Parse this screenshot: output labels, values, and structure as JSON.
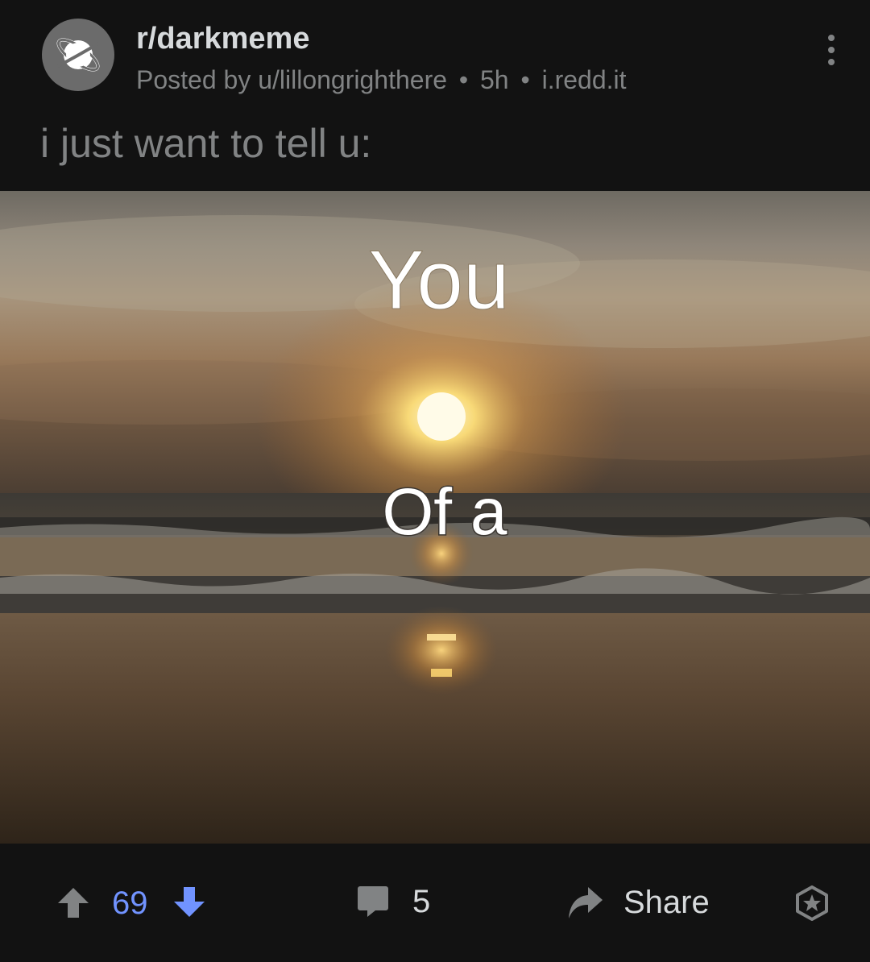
{
  "post": {
    "subreddit": "r/darkmeme",
    "posted_by": "Posted by u/lillongrighthere",
    "age": "5h",
    "domain": "i.redd.it",
    "separator": "•",
    "title": "i just want to tell u:",
    "image_text_top": "You",
    "image_text_bottom": "Of a",
    "subreddit_icon": "planet-icon"
  },
  "actions": {
    "upvote_icon": "arrow-up-icon",
    "score": "69",
    "downvote_icon": "arrow-down-icon",
    "comment_icon": "comment-bubble-icon",
    "comments": "5",
    "share_icon": "share-arrow-icon",
    "share_label": "Share",
    "award_icon": "award-star-icon",
    "vote_color": "#7193ff",
    "muted_color": "#818384"
  }
}
